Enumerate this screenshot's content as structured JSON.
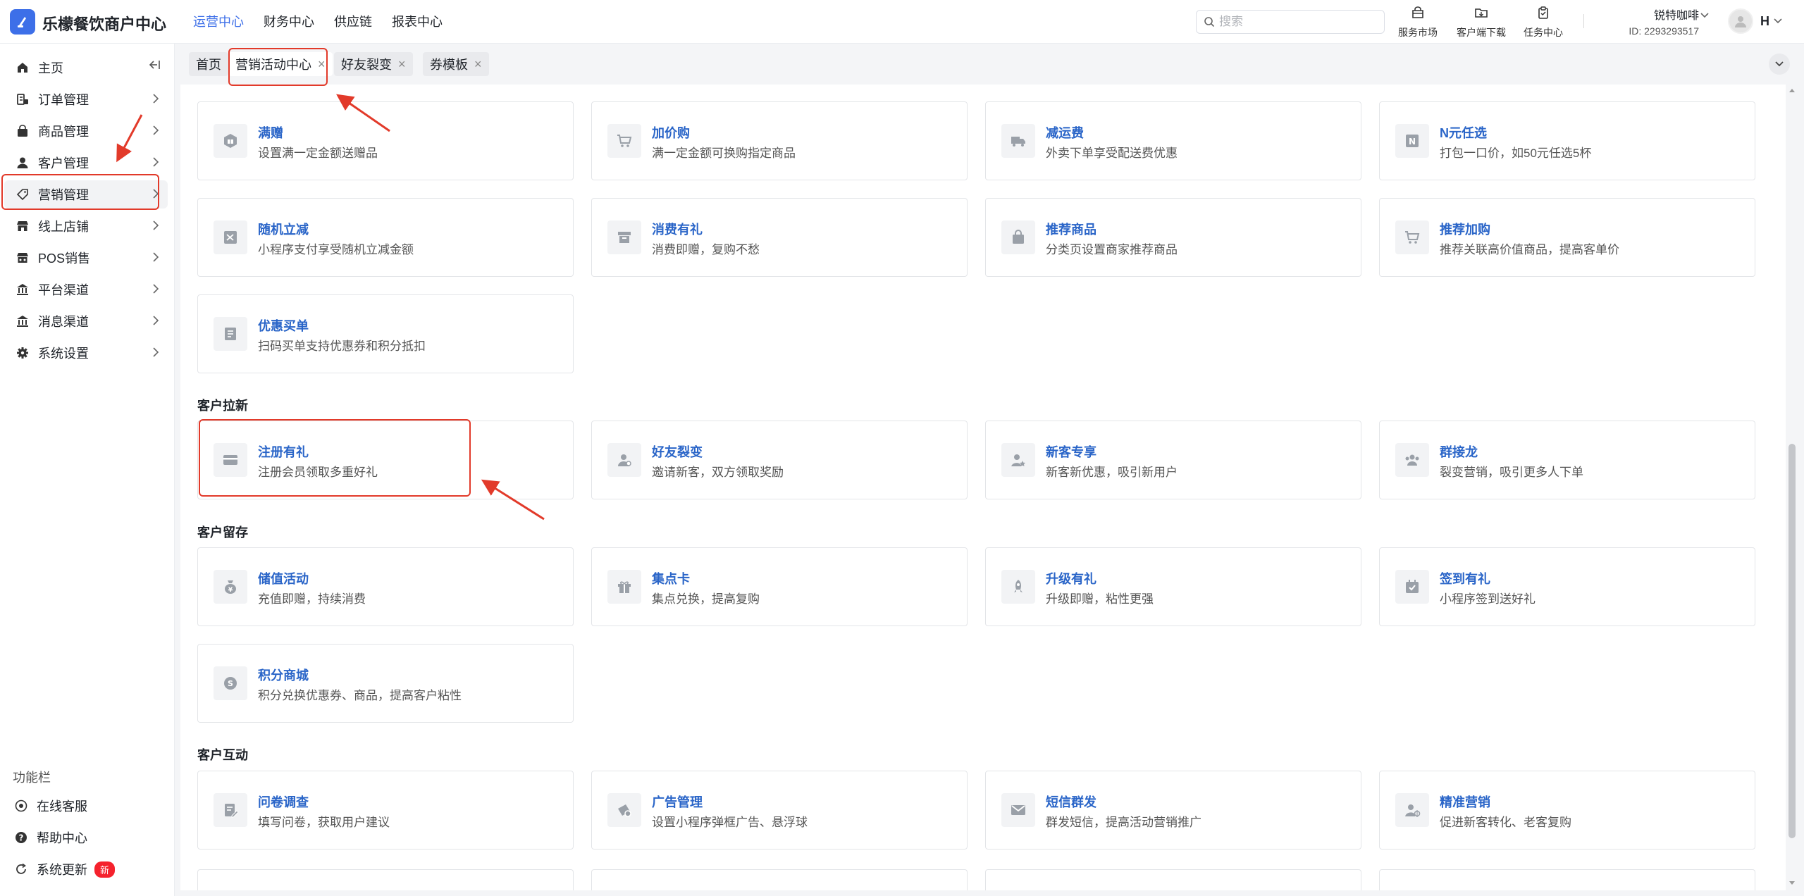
{
  "header": {
    "brand": "乐檬餐饮商户中心",
    "nav": [
      "运营中心",
      "财务中心",
      "供应链",
      "报表中心"
    ],
    "active_nav": 0,
    "search_placeholder": "搜索",
    "tools": [
      {
        "label": "服务市场",
        "icon": "shop-icon"
      },
      {
        "label": "客户端下载",
        "icon": "folder-download-icon"
      },
      {
        "label": "任务中心",
        "icon": "clipboard-icon"
      }
    ],
    "store_name": "锐特咖啡",
    "store_id": "ID: 2293293517",
    "user_initial": "H"
  },
  "sidebar": {
    "items": [
      {
        "label": "主页",
        "icon": "home-icon"
      },
      {
        "label": "订单管理",
        "icon": "order-icon"
      },
      {
        "label": "商品管理",
        "icon": "product-icon"
      },
      {
        "label": "客户管理",
        "icon": "user-icon"
      },
      {
        "label": "营销管理",
        "icon": "tag-icon"
      },
      {
        "label": "线上店铺",
        "icon": "store-icon"
      },
      {
        "label": "POS销售",
        "icon": "pos-icon"
      },
      {
        "label": "平台渠道",
        "icon": "bank-icon"
      },
      {
        "label": "消息渠道",
        "icon": "bank-icon"
      },
      {
        "label": "系统设置",
        "icon": "gear-icon"
      }
    ],
    "active_index": 4,
    "func_title": "功能栏",
    "func_items": [
      {
        "label": "在线客服",
        "icon": "headset-icon"
      },
      {
        "label": "帮助中心",
        "icon": "help-icon"
      },
      {
        "label": "系统更新",
        "icon": "refresh-icon",
        "badge": "新"
      }
    ]
  },
  "tabs": [
    {
      "label": "首页",
      "closable": false
    },
    {
      "label": "营销活动中心",
      "closable": true,
      "active": true
    },
    {
      "label": "好友裂变",
      "closable": true
    },
    {
      "label": "券模板",
      "closable": true
    }
  ],
  "sections": [
    {
      "title": "",
      "cards": [
        {
          "title": "满赠",
          "desc": "设置满一定金额送赠品"
        },
        {
          "title": "加价购",
          "desc": "满一定金额可换购指定商品"
        },
        {
          "title": "减运费",
          "desc": "外卖下单享受配送费优惠"
        },
        {
          "title": "N元任选",
          "desc": "打包一口价，如50元任选5杯"
        },
        {
          "title": "随机立减",
          "desc": "小程序支付享受随机立减金额"
        },
        {
          "title": "消费有礼",
          "desc": "消费即赠，复购不愁"
        },
        {
          "title": "推荐商品",
          "desc": "分类页设置商家推荐商品"
        },
        {
          "title": "推荐加购",
          "desc": "推荐关联高价值商品，提高客单价"
        },
        {
          "title": "优惠买单",
          "desc": "扫码买单支持优惠券和积分抵扣"
        }
      ]
    },
    {
      "title": "客户拉新",
      "cards": [
        {
          "title": "注册有礼",
          "desc": "注册会员领取多重好礼"
        },
        {
          "title": "好友裂变",
          "desc": "邀请新客，双方领取奖励"
        },
        {
          "title": "新客专享",
          "desc": "新客新优惠，吸引新用户"
        },
        {
          "title": "群接龙",
          "desc": "裂变营销，吸引更多人下单"
        }
      ]
    },
    {
      "title": "客户留存",
      "cards": [
        {
          "title": "储值活动",
          "desc": "充值即赠，持续消费"
        },
        {
          "title": "集点卡",
          "desc": "集点兑换，提高复购"
        },
        {
          "title": "升级有礼",
          "desc": "升级即赠，粘性更强"
        },
        {
          "title": "签到有礼",
          "desc": "小程序签到送好礼"
        },
        {
          "title": "积分商城",
          "desc": "积分兑换优惠券、商品，提高客户粘性"
        }
      ]
    },
    {
      "title": "客户互动",
      "cards": [
        {
          "title": "问卷调查",
          "desc": "填写问卷，获取用户建议"
        },
        {
          "title": "广告管理",
          "desc": "设置小程序弹框广告、悬浮球"
        },
        {
          "title": "短信群发",
          "desc": "群发短信，提高活动营销推广"
        },
        {
          "title": "精准营销",
          "desc": "促进新客转化、老客复购"
        }
      ]
    }
  ],
  "colors": {
    "accent": "#3d6fe8",
    "card_title": "#2a65c8",
    "annotation": "#e23a2a"
  }
}
